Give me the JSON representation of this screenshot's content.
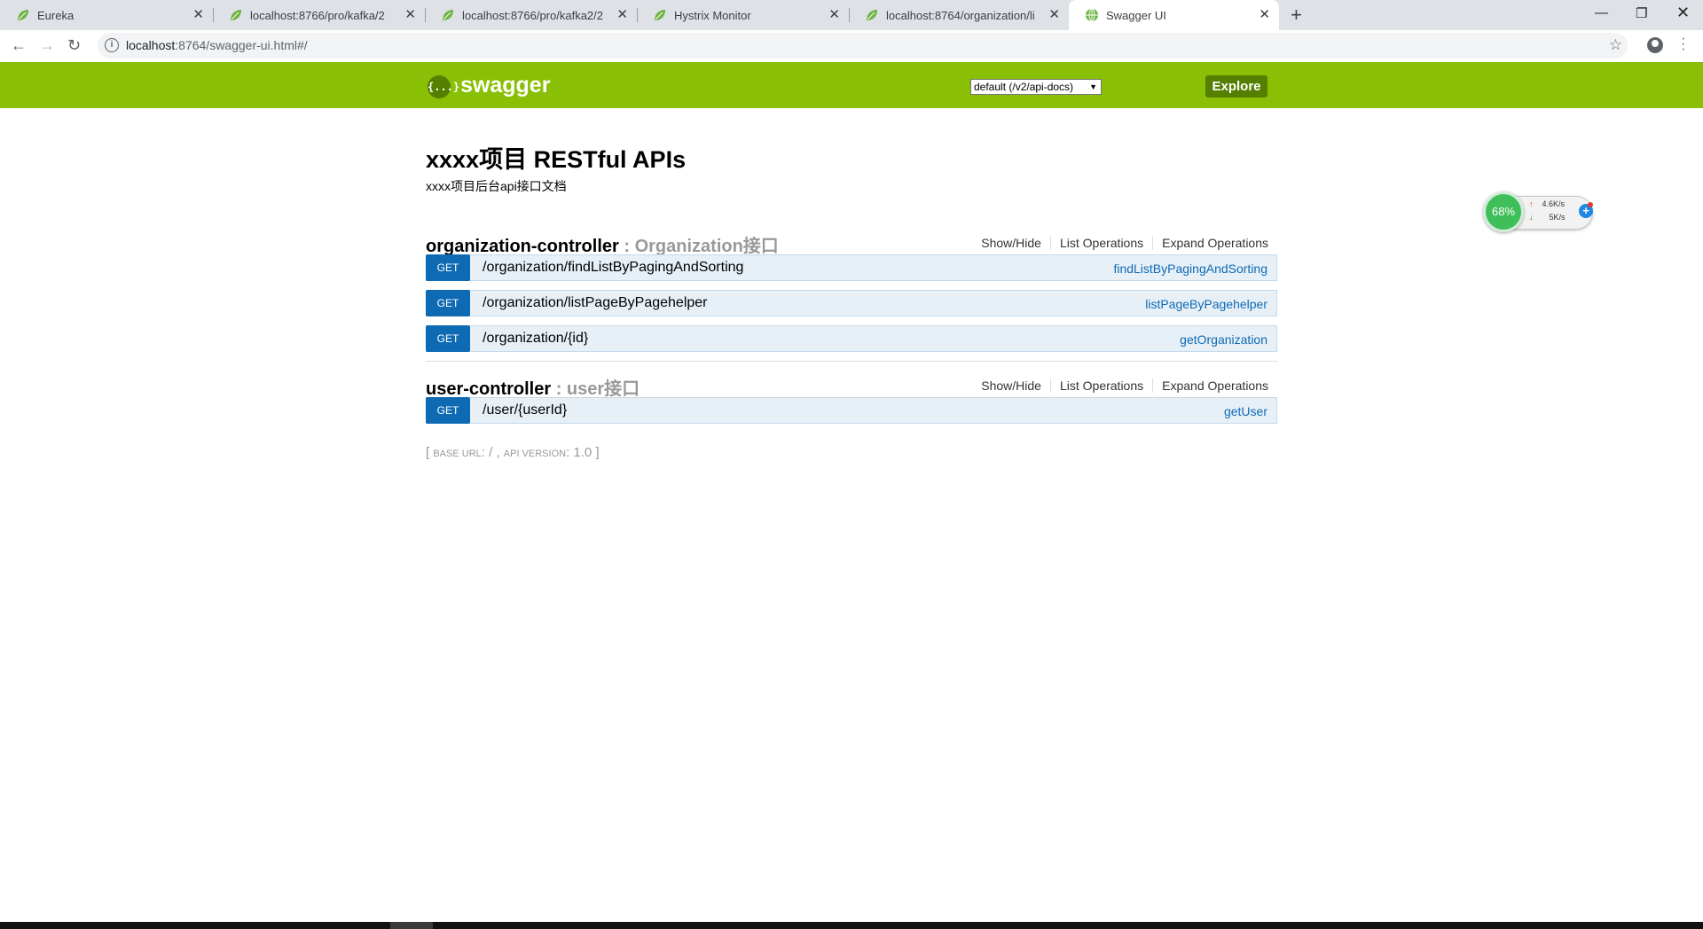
{
  "browser": {
    "tabs": [
      {
        "title": "Eureka",
        "active": false
      },
      {
        "title": "localhost:8766/pro/kafka/2",
        "active": false
      },
      {
        "title": "localhost:8766/pro/kafka2/2",
        "active": false
      },
      {
        "title": "Hystrix Monitor",
        "active": false
      },
      {
        "title": "localhost:8764/organization/li",
        "active": false
      },
      {
        "title": "Swagger UI",
        "active": true
      }
    ],
    "url_host": "localhost",
    "url_rest": ":8764/swagger-ui.html#/"
  },
  "swagger_header": {
    "logo_text": "{...}",
    "brand": "swagger",
    "spec_select": "default (/v2/api-docs)",
    "explore_label": "Explore"
  },
  "api": {
    "title": "xxxx项目 RESTful APIs",
    "description": "xxxx项目后台api接口文档"
  },
  "resources": [
    {
      "name": "organization-controller",
      "description": ": Organization接口",
      "show_hide": "Show/Hide",
      "list_ops": "List Operations",
      "expand_ops": "Expand Operations",
      "operations": [
        {
          "method": "GET",
          "path": "/organization/findListByPagingAndSorting",
          "nickname": "findListByPagingAndSorting"
        },
        {
          "method": "GET",
          "path": "/organization/listPageByPagehelper",
          "nickname": "listPageByPagehelper"
        },
        {
          "method": "GET",
          "path": "/organization/{id}",
          "nickname": "getOrganization"
        }
      ]
    },
    {
      "name": "user-controller",
      "description": ": user接口",
      "show_hide": "Show/Hide",
      "list_ops": "List Operations",
      "expand_ops": "Expand Operations",
      "operations": [
        {
          "method": "GET",
          "path": "/user/{userId}",
          "nickname": "getUser"
        }
      ]
    }
  ],
  "footer": {
    "open": "[",
    "base_url_label": "base url",
    "base_url_value": ": / ,",
    "api_version_label": "api version",
    "api_version_value": ": 1.0",
    "close": "]"
  },
  "widget": {
    "percent": "68%",
    "upload": "4.6K/s",
    "download": "5K/s"
  },
  "colors": {
    "swagger_green": "#89bf04",
    "get_blue": "#0f6ab4",
    "op_bg": "#e7f0f7"
  }
}
